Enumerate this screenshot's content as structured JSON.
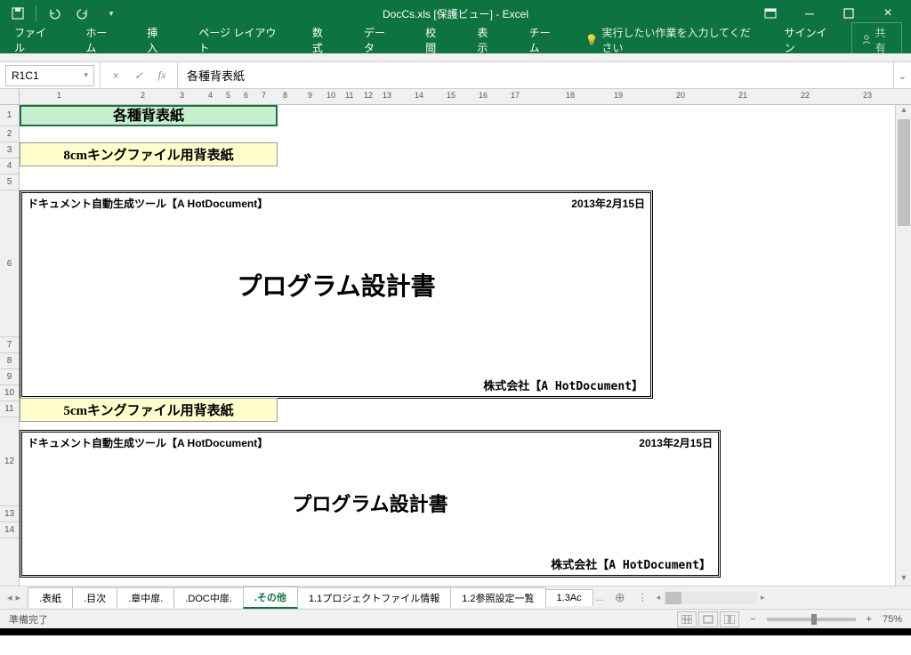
{
  "title": "DocCs.xls [保護ビュー] - Excel",
  "qat": {
    "save": "save",
    "undo": "undo",
    "redo": "redo"
  },
  "ribbon": {
    "file": "ファイル",
    "home": "ホーム",
    "insert": "挿入",
    "pagelayout": "ページ レイアウト",
    "formulas": "数式",
    "data": "データ",
    "review": "校閲",
    "view": "表示",
    "team": "チーム",
    "tellme": "実行したい作業を入力してください",
    "signin": "サインイン",
    "share": "共有"
  },
  "namebox": "R1C1",
  "formula": "各種背表紙",
  "col_ticks": [
    "1",
    "2",
    "3",
    "4",
    "5",
    "6",
    "7",
    "8",
    "9",
    "10",
    "11",
    "12",
    "13",
    "14",
    "15",
    "16",
    "17",
    "18",
    "19",
    "20",
    "21",
    "22",
    "23"
  ],
  "rows": [
    "1",
    "2",
    "3",
    "4",
    "5",
    "6",
    "7",
    "8",
    "9",
    "10",
    "11",
    "12",
    "13",
    "14"
  ],
  "cells": {
    "title_green": "各種背表紙",
    "label_8cm": "8cmキングファイル用背表紙",
    "label_5cm": "5cmキングファイル用背表紙",
    "tool_name": "ドキュメント自動生成ツール【A HotDocument】",
    "date": "2013年2月15日",
    "doc_title": "プログラム設計書",
    "company": "株式会社【A HotDocument】"
  },
  "tabs": {
    "items": [
      ".表紙",
      ".目次",
      ".章中扉.",
      ".DOC中扉.",
      ".その他",
      "1.1プロジェクトファイル情報",
      "1.2参照設定一覧",
      "1.3Ac"
    ],
    "active_index": 4,
    "more": "..."
  },
  "status": {
    "ready": "準備完了",
    "zoom": "75%",
    "plus": "+",
    "minus": "−"
  }
}
